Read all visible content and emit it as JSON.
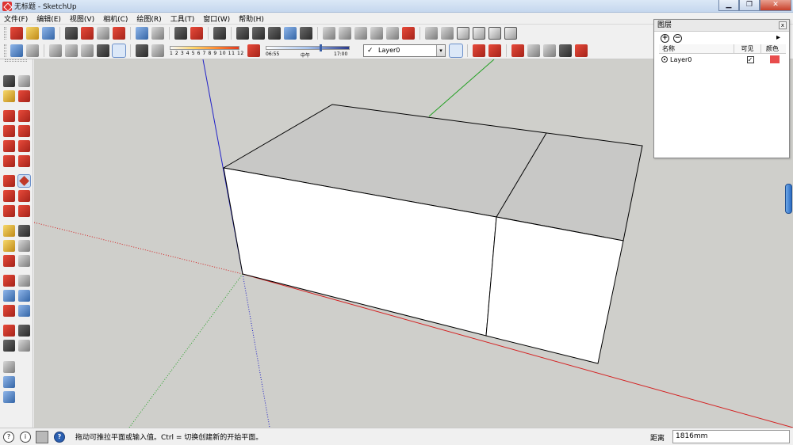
{
  "window": {
    "title": "无标题 - SketchUp",
    "controls": {
      "minimize": "▁",
      "maximize": "❐",
      "close": "✕"
    }
  },
  "menu": [
    "文件(F)",
    "编辑(E)",
    "视图(V)",
    "相机(C)",
    "绘图(R)",
    "工具(T)",
    "窗口(W)",
    "帮助(H)"
  ],
  "toolbar": {
    "shadow_months": "1 2 3 4 5 6 7 8 9 10 11 12",
    "time_start": "06:55",
    "time_mid": "中午",
    "time_end": "17:00",
    "layer_current": "Layer0",
    "layer_check": "✓",
    "dropdown_arrow": "▾"
  },
  "layers_panel": {
    "title": "图层",
    "close": "x",
    "add_icon": "+",
    "remove_icon": "−",
    "detail_icon": "▸",
    "columns": {
      "name": "名称",
      "visible": "可见",
      "color": "颜色"
    },
    "rows": [
      {
        "name": "Layer0",
        "visible_mark": "✓",
        "color": "#e84c4c"
      }
    ]
  },
  "statusbar": {
    "icons": {
      "geo": "?",
      "info": "i",
      "help": "?"
    },
    "message": "拖动可推拉平面或输入值。Ctrl = 切换创建新的开始平面。",
    "measure_label": "距离",
    "measure_value": "1816mm"
  },
  "colors": {
    "viewport_bg": "#cfcfcb",
    "axis_red": "#d42020",
    "axis_green": "#22a022",
    "axis_blue": "#2020c8",
    "face_top": "#c8c8c6",
    "face_front": "#ffffff",
    "edge": "#000000"
  }
}
